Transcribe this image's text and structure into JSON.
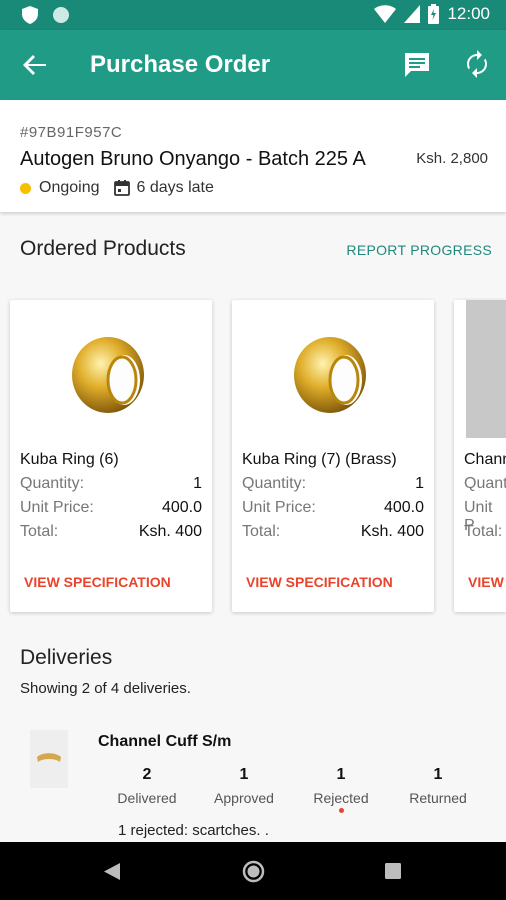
{
  "status_bar": {
    "time": "12:00"
  },
  "app_bar": {
    "title": "Purchase Order"
  },
  "order": {
    "id": "#97B91F957C",
    "name": "Autogen Bruno Onyango - Batch 225 A",
    "amount": "Ksh. 2,800",
    "status": "Ongoing",
    "late": "6 days late",
    "status_color": "#f6c000"
  },
  "ordered_products": {
    "title": "Ordered Products",
    "report_label": "REPORT PROGRESS",
    "items": [
      {
        "name": "Kuba Ring (6)",
        "quantity_label": "Quantity:",
        "quantity": "1",
        "unit_price_label": "Unit Price:",
        "unit_price": "400.0",
        "total_label": "Total:",
        "total": "Ksh. 400",
        "spec_label": "VIEW SPECIFICATION"
      },
      {
        "name": "Kuba Ring (7) (Brass)",
        "quantity_label": "Quantity:",
        "quantity": "1",
        "unit_price_label": "Unit Price:",
        "unit_price": "400.0",
        "total_label": "Total:",
        "total": "Ksh. 400",
        "spec_label": "VIEW SPECIFICATION"
      },
      {
        "name": "Chann",
        "quantity_label": "Quant",
        "unit_price_label": "Unit P",
        "total_label": "Total:",
        "spec_label": "VIEW"
      }
    ]
  },
  "deliveries": {
    "title": "Deliveries",
    "subtitle": "Showing 2 of 4 deliveries.",
    "item": {
      "name": "Channel Cuff S/m",
      "stats": [
        {
          "value": "2",
          "label": "Delivered"
        },
        {
          "value": "1",
          "label": "Approved"
        },
        {
          "value": "1",
          "label": "Rejected"
        },
        {
          "value": "1",
          "label": "Returned"
        }
      ],
      "note": "1 rejected: scartches. ."
    }
  },
  "colors": {
    "primary": "#1f9b86",
    "status_bar": "#1a8a78",
    "accent_red": "#e9442c",
    "link_teal": "#1f8a7a"
  }
}
